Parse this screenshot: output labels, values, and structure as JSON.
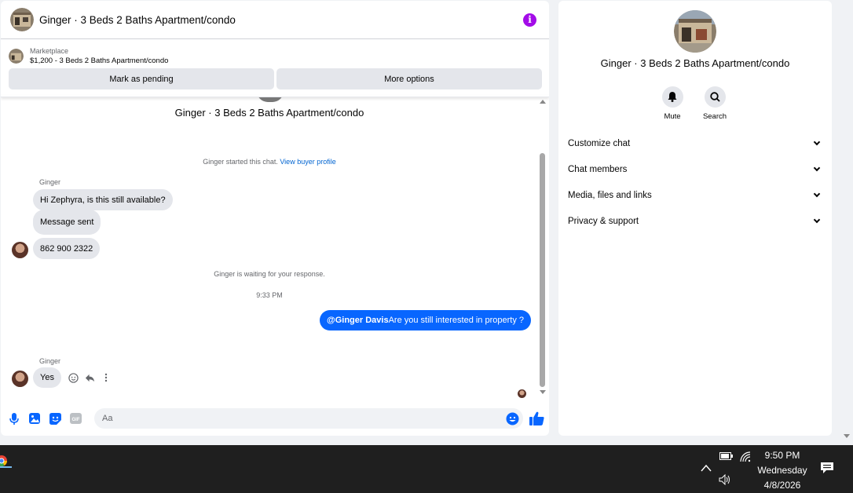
{
  "chat": {
    "title": "Ginger · 3 Beds 2 Baths Apartment/condo",
    "marketplace": {
      "label": "Marketplace",
      "listing": "$1,200 - 3 Beds 2 Baths Apartment/condo",
      "mark_pending": "Mark as pending",
      "more_options": "More options"
    },
    "conversation_title": "Ginger · 3 Beds 2 Baths Apartment/condo",
    "started_text": "Ginger started this chat.",
    "view_profile": "View buyer profile",
    "sender_name_1": "Ginger",
    "messages_in": [
      "Hi Zephyra, is this still available?",
      "Message sent",
      "862 900 2322"
    ],
    "waiting_text": "Ginger is waiting for your response.",
    "timestamp": "9:33 PM",
    "outgoing": {
      "mention": "@Ginger Davis",
      "text": "Are you still interested in property ?"
    },
    "sender_name_2": "Ginger",
    "reply": "Yes",
    "composer_placeholder": "Aa"
  },
  "details": {
    "title": "Ginger · 3 Beds 2 Baths Apartment/condo",
    "mute_label": "Mute",
    "search_label": "Search",
    "sections": [
      "Customize chat",
      "Chat members",
      "Media, files and links",
      "Privacy & support"
    ]
  },
  "taskbar": {
    "time": "9:50 PM",
    "day": "Wednesday",
    "date": "4/8/2026"
  },
  "colors": {
    "accent": "#0866ff",
    "info": "#a30ce8",
    "link": "#0064d1"
  }
}
